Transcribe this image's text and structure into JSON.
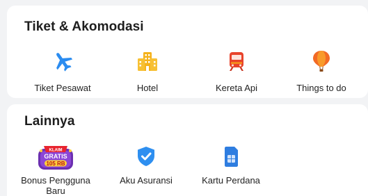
{
  "travel": {
    "title": "Tiket & Akomodasi",
    "items": [
      {
        "label": "Tiket Pesawat",
        "icon": "airplane-icon"
      },
      {
        "label": "Hotel",
        "icon": "hotel-building-icon"
      },
      {
        "label": "Kereta Api",
        "icon": "train-icon"
      },
      {
        "label": "Things to do",
        "icon": "hot-air-balloon-icon"
      }
    ]
  },
  "other": {
    "title": "Lainnya",
    "items": [
      {
        "label": "Bonus Pengguna Baru",
        "icon": "new-user-bonus-icon",
        "badge": {
          "line1": "KLAIM",
          "line2": "GRATIS",
          "line3": "105 RB"
        }
      },
      {
        "label": "Aku Asuransi",
        "icon": "insurance-shield-icon"
      },
      {
        "label": "Kartu Perdana",
        "icon": "sim-card-icon"
      }
    ]
  },
  "colors": {
    "airplane": "#2b8cf0",
    "hotel": "#f5b21b",
    "train": "#e8432b",
    "balloon": "#f26a25",
    "shield": "#2e8ff0",
    "sim": "#2e7de0",
    "bonus_purple": "#6b2fb0"
  }
}
